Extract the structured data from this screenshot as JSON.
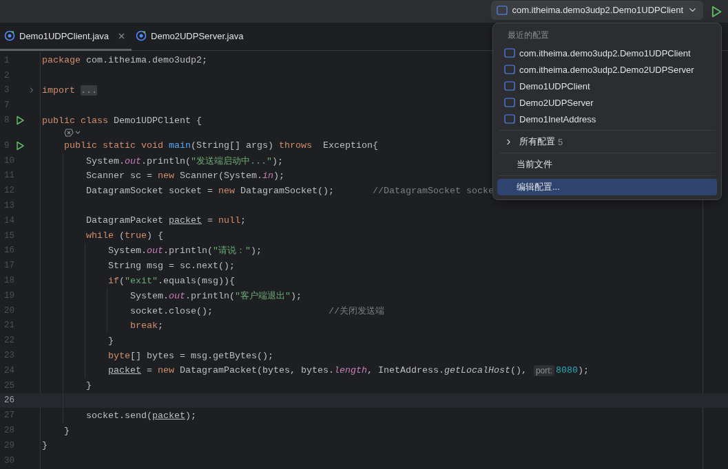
{
  "toolbar": {
    "run_config": "com.itheima.demo3udp2.Demo1UDPClient"
  },
  "tabs": [
    {
      "label": "Demo1UDPClient.java",
      "selected": true,
      "closable": true
    },
    {
      "label": "Demo2UDPServer.java",
      "selected": false,
      "closable": false
    }
  ],
  "editor": {
    "lines": [
      {
        "kind": "code",
        "number": "1",
        "current": false,
        "runnable": false,
        "foldable": false,
        "tokens": [
          {
            "kind": "kw",
            "text": "package "
          },
          {
            "kind": "plain",
            "text": "com.itheima.demo3udp2;"
          }
        ]
      },
      {
        "kind": "code",
        "number": "2",
        "current": false,
        "runnable": false,
        "foldable": false
      },
      {
        "kind": "code",
        "number": "3",
        "current": false,
        "runnable": false,
        "foldable": true,
        "tokens": [
          {
            "kind": "kw",
            "text": "import "
          },
          {
            "kind": "fold",
            "text": "..."
          }
        ]
      },
      {
        "kind": "code",
        "number": "7",
        "current": false,
        "runnable": false,
        "foldable": false
      },
      {
        "kind": "code",
        "number": "8",
        "current": false,
        "runnable": true,
        "foldable": false,
        "tokens": [
          {
            "kind": "kw",
            "text": "public class"
          },
          {
            "kind": "plain",
            "text": " Demo1UDPClient {"
          }
        ]
      },
      {
        "kind": "inlay"
      },
      {
        "kind": "code",
        "number": "9",
        "current": false,
        "runnable": true,
        "foldable": false,
        "tokens": [
          {
            "kind": "kw",
            "text": "    public static void "
          },
          {
            "kind": "method",
            "text": "main"
          },
          {
            "kind": "plain",
            "text": "(String[] args) "
          },
          {
            "kind": "kw",
            "text": "throws"
          },
          {
            "kind": "plain",
            "text": "  Exception{"
          }
        ]
      },
      {
        "kind": "code",
        "number": "10",
        "current": false,
        "runnable": false,
        "foldable": false,
        "tokens": [
          {
            "kind": "plain",
            "text": "        System."
          },
          {
            "kind": "field",
            "text": "out"
          },
          {
            "kind": "plain",
            "text": ".println("
          },
          {
            "kind": "str",
            "text": "\"发送端启动中...\""
          },
          {
            "kind": "plain",
            "text": ");"
          }
        ]
      },
      {
        "kind": "code",
        "number": "11",
        "current": false,
        "runnable": false,
        "foldable": false,
        "tokens": [
          {
            "kind": "plain",
            "text": "        Scanner sc = "
          },
          {
            "kind": "kw",
            "text": "new"
          },
          {
            "kind": "plain",
            "text": " Scanner(System."
          },
          {
            "kind": "field",
            "text": "in"
          },
          {
            "kind": "plain",
            "text": ");"
          }
        ]
      },
      {
        "kind": "code",
        "number": "12",
        "current": false,
        "runnable": false,
        "foldable": false,
        "tokens": [
          {
            "kind": "plain",
            "text": "        DatagramSocket socket = "
          },
          {
            "kind": "kw",
            "text": "new"
          },
          {
            "kind": "plain",
            "text": " DatagramSocket();       "
          },
          {
            "kind": "comment",
            "text": "//DatagramSocket socke"
          }
        ]
      },
      {
        "kind": "code",
        "number": "13",
        "current": false,
        "runnable": false,
        "foldable": false
      },
      {
        "kind": "code",
        "number": "14",
        "current": false,
        "runnable": false,
        "foldable": false,
        "tokens": [
          {
            "kind": "plain",
            "text": "        DatagramPacket "
          },
          {
            "kind": "var",
            "text": "packet"
          },
          {
            "kind": "plain",
            "text": " = "
          },
          {
            "kind": "kw",
            "text": "null"
          },
          {
            "kind": "plain",
            "text": ";"
          }
        ]
      },
      {
        "kind": "code",
        "number": "15",
        "current": false,
        "runnable": false,
        "foldable": false,
        "tokens": [
          {
            "kind": "kw",
            "text": "        while"
          },
          {
            "kind": "plain",
            "text": " ("
          },
          {
            "kind": "kw",
            "text": "true"
          },
          {
            "kind": "plain",
            "text": ") {"
          }
        ]
      },
      {
        "kind": "code",
        "number": "16",
        "current": false,
        "runnable": false,
        "foldable": false,
        "tokens": [
          {
            "kind": "plain",
            "text": "            System."
          },
          {
            "kind": "field",
            "text": "out"
          },
          {
            "kind": "plain",
            "text": ".println("
          },
          {
            "kind": "str",
            "text": "\"请说：\""
          },
          {
            "kind": "plain",
            "text": ");"
          }
        ]
      },
      {
        "kind": "code",
        "number": "17",
        "current": false,
        "runnable": false,
        "foldable": false,
        "tokens": [
          {
            "kind": "plain",
            "text": "            String msg = sc.next();"
          }
        ]
      },
      {
        "kind": "code",
        "number": "18",
        "current": false,
        "runnable": false,
        "foldable": false,
        "tokens": [
          {
            "kind": "kw",
            "text": "            if"
          },
          {
            "kind": "plain",
            "text": "("
          },
          {
            "kind": "str",
            "text": "\"exit\""
          },
          {
            "kind": "plain",
            "text": ".equals(msg)){"
          }
        ]
      },
      {
        "kind": "code",
        "number": "19",
        "current": false,
        "runnable": false,
        "foldable": false,
        "tokens": [
          {
            "kind": "plain",
            "text": "                System."
          },
          {
            "kind": "field",
            "text": "out"
          },
          {
            "kind": "plain",
            "text": ".println("
          },
          {
            "kind": "str",
            "text": "\"客户端退出\""
          },
          {
            "kind": "plain",
            "text": ");"
          }
        ]
      },
      {
        "kind": "code",
        "number": "20",
        "current": false,
        "runnable": false,
        "foldable": false,
        "tokens": [
          {
            "kind": "plain",
            "text": "                socket.close();                     "
          },
          {
            "kind": "comment",
            "text": "//关闭发送端"
          }
        ]
      },
      {
        "kind": "code",
        "number": "21",
        "current": false,
        "runnable": false,
        "foldable": false,
        "tokens": [
          {
            "kind": "kw",
            "text": "                break"
          },
          {
            "kind": "plain",
            "text": ";"
          }
        ]
      },
      {
        "kind": "code",
        "number": "22",
        "current": false,
        "runnable": false,
        "foldable": false,
        "tokens": [
          {
            "kind": "plain",
            "text": "            }"
          }
        ]
      },
      {
        "kind": "code",
        "number": "23",
        "current": false,
        "runnable": false,
        "foldable": false,
        "tokens": [
          {
            "kind": "kw",
            "text": "            byte"
          },
          {
            "kind": "plain",
            "text": "[] bytes = msg.getBytes();"
          }
        ]
      },
      {
        "kind": "code",
        "number": "24",
        "current": false,
        "runnable": false,
        "foldable": false,
        "tokens": [
          {
            "kind": "var",
            "text": "            packet"
          },
          {
            "kind": "plain",
            "text": " = "
          },
          {
            "kind": "kw",
            "text": "new"
          },
          {
            "kind": "plain",
            "text": " DatagramPacket(bytes, bytes."
          },
          {
            "kind": "field",
            "text": "length"
          },
          {
            "kind": "plain",
            "text": ", InetAddress."
          },
          {
            "kind": "static",
            "text": "getLocalHost"
          },
          {
            "kind": "plain",
            "text": "(), "
          },
          {
            "kind": "hint",
            "text": "port:"
          },
          {
            "kind": "num",
            "text": "8080"
          },
          {
            "kind": "plain",
            "text": ");"
          }
        ]
      },
      {
        "kind": "code",
        "number": "25",
        "current": false,
        "runnable": false,
        "foldable": false,
        "tokens": [
          {
            "kind": "plain",
            "text": "        }"
          }
        ]
      },
      {
        "kind": "code",
        "number": "26",
        "current": true,
        "runnable": false,
        "foldable": false
      },
      {
        "kind": "code",
        "number": "27",
        "current": false,
        "runnable": false,
        "foldable": false,
        "tokens": [
          {
            "kind": "plain",
            "text": "        socket.send("
          },
          {
            "kind": "var",
            "text": "packet"
          },
          {
            "kind": "plain",
            "text": ");"
          }
        ]
      },
      {
        "kind": "code",
        "number": "28",
        "current": false,
        "runnable": false,
        "foldable": false,
        "tokens": [
          {
            "kind": "plain",
            "text": "    }"
          }
        ]
      },
      {
        "kind": "code",
        "number": "29",
        "current": false,
        "runnable": false,
        "foldable": false,
        "tokens": [
          {
            "kind": "plain",
            "text": "}"
          }
        ]
      },
      {
        "kind": "code",
        "number": "30",
        "current": false,
        "runnable": false,
        "foldable": false
      }
    ]
  },
  "popup": {
    "header": "最近的配置",
    "sections": [
      {
        "items": [
          {
            "kind": "config",
            "label": "com.itheima.demo3udp2.Demo1UDPClient",
            "selected": false
          },
          {
            "kind": "config",
            "label": "com.itheima.demo3udp2.Demo2UDPServer",
            "selected": false
          },
          {
            "kind": "config",
            "label": "Demo1UDPClient",
            "selected": false
          },
          {
            "kind": "config",
            "label": "Demo2UDPServer",
            "selected": false
          },
          {
            "kind": "config",
            "label": "Demo1InetAddress",
            "selected": false
          }
        ]
      },
      {
        "items": [
          {
            "kind": "group",
            "label": "所有配置",
            "count": "5",
            "selected": false
          }
        ]
      },
      {
        "items": [
          {
            "kind": "action",
            "label": "当前文件",
            "selected": false
          }
        ]
      },
      {
        "items": [
          {
            "kind": "action",
            "label": "编辑配置...",
            "selected": true
          }
        ]
      }
    ]
  }
}
